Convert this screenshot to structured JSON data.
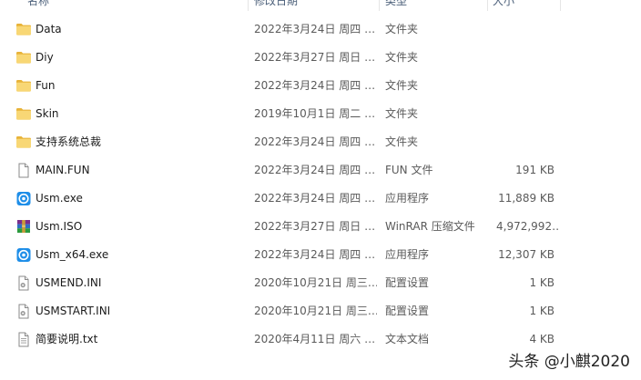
{
  "columns": {
    "name": "名称",
    "date": "修改日期",
    "type": "类型",
    "size": "大小"
  },
  "files": [
    {
      "icon": "folder-icon",
      "name": "Data",
      "date": "2022年3月24日 周四 …",
      "type": "文件夹",
      "size": ""
    },
    {
      "icon": "folder-icon",
      "name": "Diy",
      "date": "2022年3月27日 周日 …",
      "type": "文件夹",
      "size": ""
    },
    {
      "icon": "folder-icon",
      "name": "Fun",
      "date": "2022年3月24日 周四 …",
      "type": "文件夹",
      "size": ""
    },
    {
      "icon": "folder-icon",
      "name": "Skin",
      "date": "2019年10月1日 周二 …",
      "type": "文件夹",
      "size": ""
    },
    {
      "icon": "folder-icon",
      "name": "支持系统总裁",
      "date": "2022年3月24日 周四 …",
      "type": "文件夹",
      "size": ""
    },
    {
      "icon": "file-icon",
      "name": "MAIN.FUN",
      "date": "2022年3月24日 周四 …",
      "type": "FUN 文件",
      "size": "191 KB"
    },
    {
      "icon": "exe-icon",
      "name": "Usm.exe",
      "date": "2022年3月24日 周四 …",
      "type": "应用程序",
      "size": "11,889 KB"
    },
    {
      "icon": "winrar-icon",
      "name": "Usm.ISO",
      "date": "2022年3月27日 周日 …",
      "type": "WinRAR 压缩文件",
      "size": "4,972,992…"
    },
    {
      "icon": "exe-icon",
      "name": "Usm_x64.exe",
      "date": "2022年3月24日 周四 …",
      "type": "应用程序",
      "size": "12,307 KB"
    },
    {
      "icon": "ini-icon",
      "name": "USMEND.INI",
      "date": "2020年10月21日 周三…",
      "type": "配置设置",
      "size": "1 KB"
    },
    {
      "icon": "ini-icon",
      "name": "USMSTART.INI",
      "date": "2020年10月21日 周三…",
      "type": "配置设置",
      "size": "1 KB"
    },
    {
      "icon": "text-file-icon",
      "name": "简要说明.txt",
      "date": "2020年4月11日 周六 …",
      "type": "文本文档",
      "size": "4 KB"
    }
  ],
  "watermark": "头条 @小麒2020",
  "colors": {
    "folder": "#f8d775",
    "folder_dark": "#e8b339",
    "exe_blue": "#1e90ff",
    "header_text": "#4c607a"
  }
}
